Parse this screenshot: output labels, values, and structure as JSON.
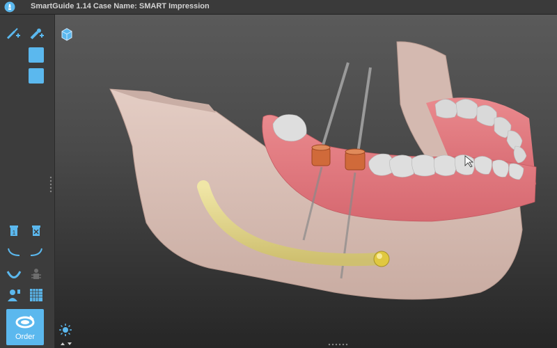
{
  "window": {
    "title": "SmartGuide 1.14 Case Name: SMART Impression"
  },
  "sidebar": {
    "tools": [
      {
        "icon": "add-implant-icon"
      },
      {
        "icon": "add-sleeve-icon"
      },
      {
        "icon": "view-square-icon"
      },
      {
        "icon": "view-square-icon"
      },
      {
        "icon": "delete-one-icon"
      },
      {
        "icon": "delete-all-icon"
      },
      {
        "icon": "curve-left-icon"
      },
      {
        "icon": "curve-right-icon"
      },
      {
        "icon": "arch-icon"
      },
      {
        "icon": "nerve-icon"
      },
      {
        "icon": "patient-icon"
      },
      {
        "icon": "grid-icon"
      }
    ],
    "order_button": {
      "label": "Order",
      "icon": "order-icon"
    }
  },
  "viewport": {
    "icons": [
      "view-cube-icon",
      "lighting-icon"
    ]
  },
  "colors": {
    "accent": "#5bb8ee",
    "bone": "#d8c0b8",
    "gum": "#e07a80",
    "teeth": "#d9d9d9",
    "nerve": "#e8dc8a",
    "sleeve": "#d06a3a"
  }
}
